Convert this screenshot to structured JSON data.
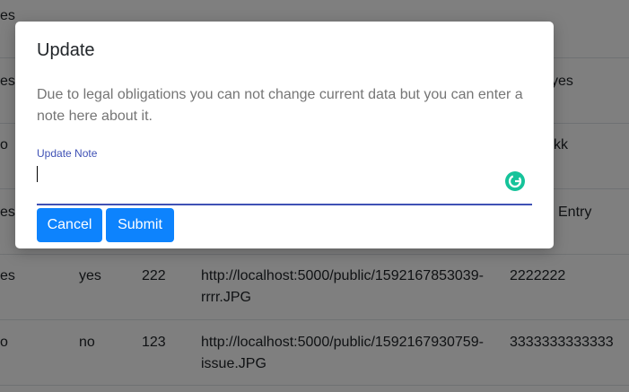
{
  "background_table": {
    "rows": [
      {
        "c1": "es",
        "c2": "",
        "c3": "",
        "c4": [],
        "c5": ""
      },
      {
        "c1": "es",
        "c2": "",
        "c3": "",
        "c4": [],
        "c5": "yes"
      },
      {
        "c1": "o",
        "c2": "",
        "c3": "",
        "c4": [],
        "c5": "kk"
      },
      {
        "c1": "es",
        "c2": "",
        "c3": "",
        "c4": [],
        "c5": "Entry"
      },
      {
        "c1": "es",
        "c2": "yes",
        "c3": "222",
        "c4": [
          "http://localhost:5000/public/1592167853039-",
          "rrrr.JPG"
        ],
        "c5": "2222222"
      },
      {
        "c1": "o",
        "c2": "no",
        "c3": "123",
        "c4": [
          "http://localhost:5000/public/1592167930759-",
          "issue.JPG"
        ],
        "c5": "3333333333333"
      }
    ]
  },
  "modal": {
    "title": "Update",
    "message": "Due to legal obligations you can not change current data but you can enter a note here about it.",
    "field_label": "Update Note",
    "field_value": "",
    "cancel_label": "Cancel",
    "submit_label": "Submit"
  },
  "colors": {
    "primary_button": "#0d83fd",
    "field_accent": "#3f51b5",
    "grammarly": "#15c39a",
    "overlay": "rgba(0,0,0,0.5)"
  },
  "icons": {
    "grammarly": "grammarly-icon"
  }
}
